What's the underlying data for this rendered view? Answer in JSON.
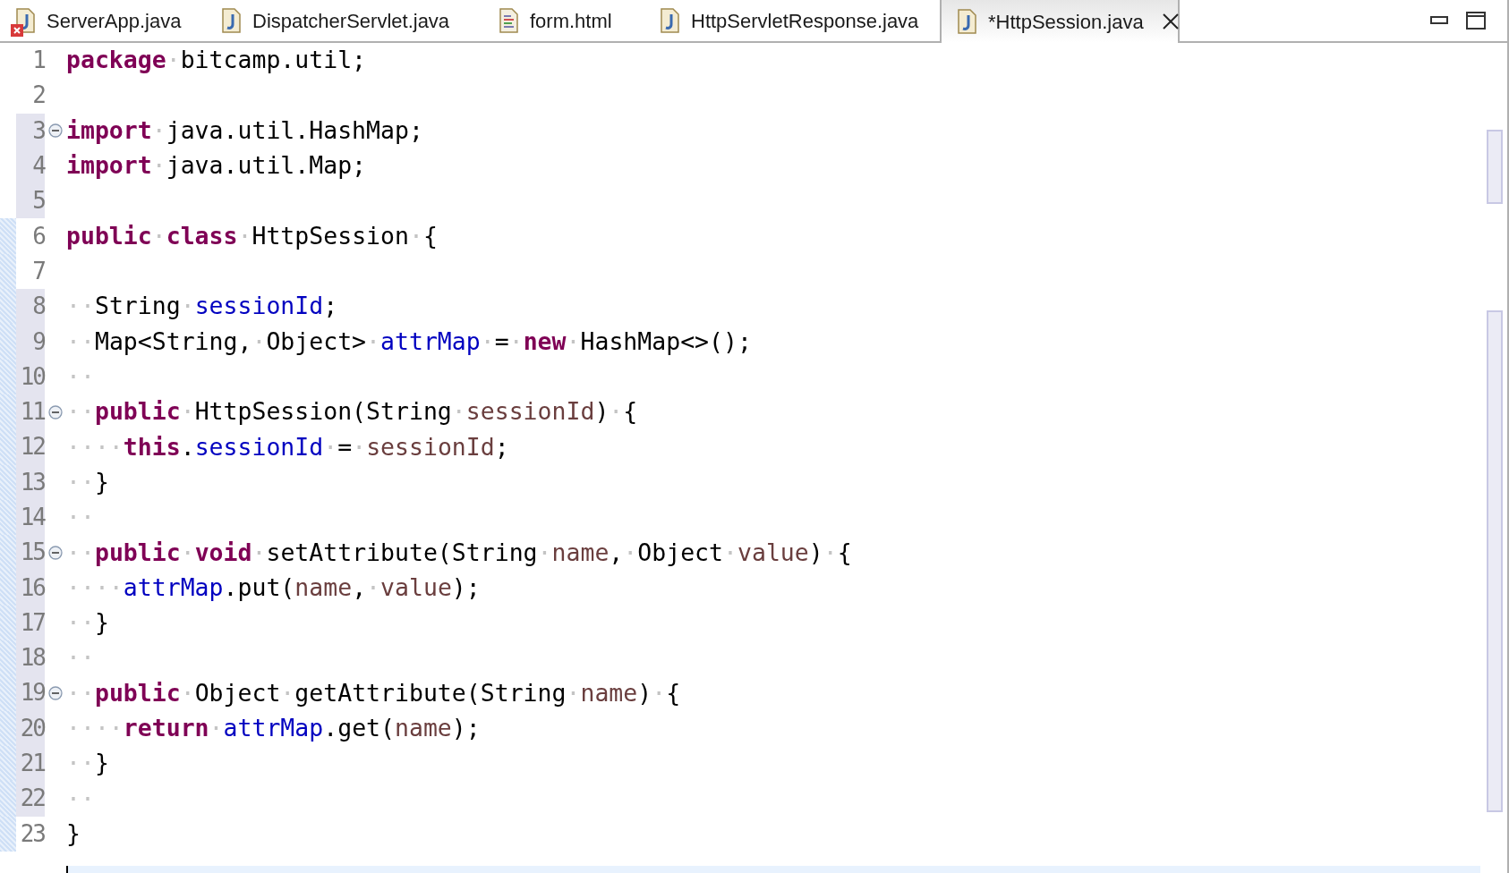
{
  "tabs": [
    {
      "label": "ServerApp.java",
      "kind": "java",
      "error": true,
      "selected": false
    },
    {
      "label": "DispatcherServlet.java",
      "kind": "java",
      "error": false,
      "selected": false
    },
    {
      "label": "form.html",
      "kind": "html",
      "error": false,
      "selected": false
    },
    {
      "label": "HttpServletResponse.java",
      "kind": "java",
      "error": false,
      "selected": false
    },
    {
      "label": "*HttpSession.java",
      "kind": "java",
      "error": false,
      "selected": true
    }
  ],
  "editor": {
    "lines": [
      {
        "number": "1",
        "marked": false,
        "added": false,
        "tokens": [
          {
            "kind": "keyword",
            "text": "package"
          },
          {
            "kind": "ws",
            "text": "·"
          },
          {
            "kind": "plain",
            "text": "bitcamp.util;"
          }
        ]
      },
      {
        "number": "2",
        "marked": false,
        "added": false
      },
      {
        "number": "3",
        "marked": true,
        "added": false,
        "fold_expanded": true,
        "tokens": [
          {
            "kind": "keyword",
            "text": "import"
          },
          {
            "kind": "ws",
            "text": "·"
          },
          {
            "kind": "plain",
            "text": "java.util.HashMap;"
          }
        ]
      },
      {
        "number": "4",
        "marked": true,
        "added": false,
        "tokens": [
          {
            "kind": "keyword",
            "text": "import"
          },
          {
            "kind": "ws",
            "text": "·"
          },
          {
            "kind": "plain",
            "text": "java.util.Map;"
          }
        ]
      },
      {
        "number": "5",
        "marked": true,
        "added": false
      },
      {
        "number": "6",
        "marked": false,
        "added": true,
        "tokens": [
          {
            "kind": "keyword",
            "text": "public"
          },
          {
            "kind": "ws",
            "text": "·"
          },
          {
            "kind": "keyword",
            "text": "class"
          },
          {
            "kind": "ws",
            "text": "·"
          },
          {
            "kind": "plain",
            "text": "HttpSession"
          },
          {
            "kind": "ws",
            "text": "·"
          },
          {
            "kind": "plain",
            "text": "{"
          }
        ]
      },
      {
        "number": "7",
        "marked": false,
        "added": true
      },
      {
        "number": "8",
        "marked": true,
        "added": true,
        "tokens": [
          {
            "kind": "ws",
            "text": "··"
          },
          {
            "kind": "plain",
            "text": "String"
          },
          {
            "kind": "ws",
            "text": "·"
          },
          {
            "kind": "field",
            "text": "sessionId"
          },
          {
            "kind": "plain",
            "text": ";"
          }
        ]
      },
      {
        "number": "9",
        "marked": true,
        "added": true,
        "tokens": [
          {
            "kind": "ws",
            "text": "··"
          },
          {
            "kind": "plain",
            "text": "Map<String,"
          },
          {
            "kind": "ws",
            "text": "·"
          },
          {
            "kind": "plain",
            "text": "Object>"
          },
          {
            "kind": "ws",
            "text": "·"
          },
          {
            "kind": "field",
            "text": "attrMap"
          },
          {
            "kind": "ws",
            "text": "·"
          },
          {
            "kind": "plain",
            "text": "="
          },
          {
            "kind": "ws",
            "text": "·"
          },
          {
            "kind": "keyword",
            "text": "new"
          },
          {
            "kind": "ws",
            "text": "·"
          },
          {
            "kind": "plain",
            "text": "HashMap<>();"
          }
        ]
      },
      {
        "number": "10",
        "marked": true,
        "added": true,
        "tokens": [
          {
            "kind": "ws",
            "text": "··"
          }
        ]
      },
      {
        "number": "11",
        "marked": true,
        "added": true,
        "fold_expanded": true,
        "tokens": [
          {
            "kind": "ws",
            "text": "··"
          },
          {
            "kind": "keyword",
            "text": "public"
          },
          {
            "kind": "ws",
            "text": "·"
          },
          {
            "kind": "plain",
            "text": "HttpSession(String"
          },
          {
            "kind": "ws",
            "text": "·"
          },
          {
            "kind": "param",
            "text": "sessionId"
          },
          {
            "kind": "plain",
            "text": ")"
          },
          {
            "kind": "ws",
            "text": "·"
          },
          {
            "kind": "plain",
            "text": "{"
          }
        ]
      },
      {
        "number": "12",
        "marked": true,
        "added": true,
        "tokens": [
          {
            "kind": "ws",
            "text": "····"
          },
          {
            "kind": "keyword",
            "text": "this"
          },
          {
            "kind": "plain",
            "text": "."
          },
          {
            "kind": "field",
            "text": "sessionId"
          },
          {
            "kind": "ws",
            "text": "·"
          },
          {
            "kind": "plain",
            "text": "="
          },
          {
            "kind": "ws",
            "text": "·"
          },
          {
            "kind": "param",
            "text": "sessionId"
          },
          {
            "kind": "plain",
            "text": ";"
          }
        ]
      },
      {
        "number": "13",
        "marked": true,
        "added": true,
        "tokens": [
          {
            "kind": "ws",
            "text": "··"
          },
          {
            "kind": "plain",
            "text": "}"
          }
        ]
      },
      {
        "number": "14",
        "marked": true,
        "added": true,
        "tokens": [
          {
            "kind": "ws",
            "text": "··"
          }
        ]
      },
      {
        "number": "15",
        "marked": true,
        "added": true,
        "fold_expanded": true,
        "tokens": [
          {
            "kind": "ws",
            "text": "··"
          },
          {
            "kind": "keyword",
            "text": "public"
          },
          {
            "kind": "ws",
            "text": "·"
          },
          {
            "kind": "keyword",
            "text": "void"
          },
          {
            "kind": "ws",
            "text": "·"
          },
          {
            "kind": "plain",
            "text": "setAttribute(String"
          },
          {
            "kind": "ws",
            "text": "·"
          },
          {
            "kind": "param",
            "text": "name"
          },
          {
            "kind": "plain",
            "text": ","
          },
          {
            "kind": "ws",
            "text": "·"
          },
          {
            "kind": "plain",
            "text": "Object"
          },
          {
            "kind": "ws",
            "text": "·"
          },
          {
            "kind": "param",
            "text": "value"
          },
          {
            "kind": "plain",
            "text": ")"
          },
          {
            "kind": "ws",
            "text": "·"
          },
          {
            "kind": "plain",
            "text": "{"
          }
        ]
      },
      {
        "number": "16",
        "marked": true,
        "added": true,
        "tokens": [
          {
            "kind": "ws",
            "text": "····"
          },
          {
            "kind": "field",
            "text": "attrMap"
          },
          {
            "kind": "plain",
            "text": ".put("
          },
          {
            "kind": "param",
            "text": "name"
          },
          {
            "kind": "plain",
            "text": ","
          },
          {
            "kind": "ws",
            "text": "·"
          },
          {
            "kind": "param",
            "text": "value"
          },
          {
            "kind": "plain",
            "text": ");"
          }
        ]
      },
      {
        "number": "17",
        "marked": true,
        "added": true,
        "tokens": [
          {
            "kind": "ws",
            "text": "··"
          },
          {
            "kind": "plain",
            "text": "}"
          }
        ]
      },
      {
        "number": "18",
        "marked": true,
        "added": true,
        "tokens": [
          {
            "kind": "ws",
            "text": "··"
          }
        ]
      },
      {
        "number": "19",
        "marked": true,
        "added": true,
        "fold_expanded": true,
        "tokens": [
          {
            "kind": "ws",
            "text": "··"
          },
          {
            "kind": "keyword",
            "text": "public"
          },
          {
            "kind": "ws",
            "text": "·"
          },
          {
            "kind": "plain",
            "text": "Object"
          },
          {
            "kind": "ws",
            "text": "·"
          },
          {
            "kind": "plain",
            "text": "getAttribute(String"
          },
          {
            "kind": "ws",
            "text": "·"
          },
          {
            "kind": "param",
            "text": "name"
          },
          {
            "kind": "plain",
            "text": ")"
          },
          {
            "kind": "ws",
            "text": "·"
          },
          {
            "kind": "plain",
            "text": "{"
          }
        ]
      },
      {
        "number": "20",
        "marked": true,
        "added": true,
        "tokens": [
          {
            "kind": "ws",
            "text": "····"
          },
          {
            "kind": "keyword",
            "text": "return"
          },
          {
            "kind": "ws",
            "text": "·"
          },
          {
            "kind": "field",
            "text": "attrMap"
          },
          {
            "kind": "plain",
            "text": ".get("
          },
          {
            "kind": "param",
            "text": "name"
          },
          {
            "kind": "plain",
            "text": ");"
          }
        ]
      },
      {
        "number": "21",
        "marked": true,
        "added": true,
        "tokens": [
          {
            "kind": "ws",
            "text": "··"
          },
          {
            "kind": "plain",
            "text": "}"
          }
        ]
      },
      {
        "number": "22",
        "marked": true,
        "added": true,
        "tokens": [
          {
            "kind": "ws",
            "text": "··"
          }
        ]
      },
      {
        "number": "23",
        "marked": false,
        "added": true,
        "tokens": [
          {
            "kind": "plain",
            "text": "}"
          }
        ]
      }
    ]
  }
}
